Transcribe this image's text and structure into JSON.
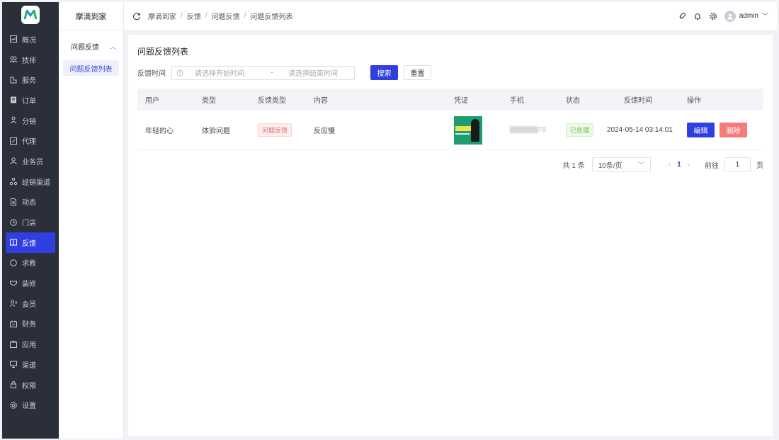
{
  "app": {
    "name": "摩滴到家"
  },
  "colors": {
    "primary": "#2f3fe0",
    "nav_bg": "#2b2f3a",
    "danger": "#f57b7b",
    "logo_green": "#1fb85c"
  },
  "nav": {
    "items": [
      {
        "label": "概况",
        "icon": "chart-icon"
      },
      {
        "label": "技师",
        "icon": "team-icon"
      },
      {
        "label": "服务",
        "icon": "service-icon"
      },
      {
        "label": "订单",
        "icon": "order-icon"
      },
      {
        "label": "分销",
        "icon": "share-icon"
      },
      {
        "label": "代理",
        "icon": "agent-icon"
      },
      {
        "label": "业务员",
        "icon": "user-icon"
      },
      {
        "label": "经销渠道",
        "icon": "network-icon"
      },
      {
        "label": "动态",
        "icon": "doc-icon"
      },
      {
        "label": "门店",
        "icon": "store-icon"
      },
      {
        "label": "反馈",
        "icon": "book-icon"
      },
      {
        "label": "求救",
        "icon": "circle-icon"
      },
      {
        "label": "装修",
        "icon": "brush-icon"
      },
      {
        "label": "会员",
        "icon": "member-icon"
      },
      {
        "label": "财务",
        "icon": "finance-icon"
      },
      {
        "label": "应用",
        "icon": "app-icon"
      },
      {
        "label": "渠道",
        "icon": "channel-icon"
      },
      {
        "label": "权限",
        "icon": "lock-icon"
      },
      {
        "label": "设置",
        "icon": "gear-icon"
      }
    ],
    "active": "反馈"
  },
  "submenu": {
    "title": "摩滴到家",
    "group": "问题反馈",
    "item": "问题反馈列表"
  },
  "breadcrumb": [
    "摩滴到家",
    "反馈",
    "问题反馈",
    "问题反馈列表"
  ],
  "header": {
    "user": "admin"
  },
  "page": {
    "title": "问题反馈列表"
  },
  "filter": {
    "label": "反馈时间",
    "start_placeholder": "请选择开始时间",
    "dash": "-",
    "end_placeholder": "请选择结束时间",
    "search": "搜索",
    "reset": "重置"
  },
  "table": {
    "headers": {
      "user": "用户",
      "type": "类型",
      "fb_type": "反馈类型",
      "content": "内容",
      "proof": "凭证",
      "phone": "手机",
      "status": "状态",
      "time": "反馈时间",
      "ops": "操作"
    },
    "rows": [
      {
        "user": "年轻的心",
        "type": "体验问题",
        "fb_type": "问题反馈",
        "content": "反应慢",
        "phone_suffix": "76",
        "status": "已处理",
        "time": "2024-05-14 03:14:01",
        "edit": "编辑",
        "delete": "删除"
      }
    ]
  },
  "pagination": {
    "total": "共 1 条",
    "page_size": "10条/页",
    "current": "1",
    "goto": "前往",
    "goto_value": "1",
    "page_suffix": "页"
  }
}
